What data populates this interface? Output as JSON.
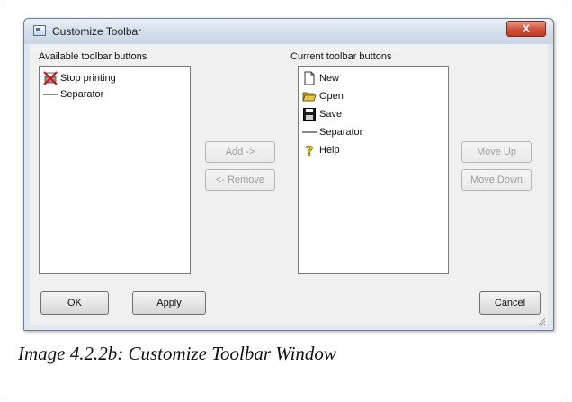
{
  "window": {
    "title": "Customize Toolbar",
    "close_label": "X"
  },
  "available": {
    "label": "Available toolbar buttons",
    "items": [
      {
        "label": "Stop printing",
        "icon": "stop-printing-icon"
      },
      {
        "label": "Separator",
        "icon": "separator-icon"
      }
    ]
  },
  "current": {
    "label": "Current toolbar buttons",
    "items": [
      {
        "label": "New",
        "icon": "new-document-icon"
      },
      {
        "label": "Open",
        "icon": "open-folder-icon"
      },
      {
        "label": "Save",
        "icon": "floppy-disk-icon"
      },
      {
        "label": "Separator",
        "icon": "separator-icon"
      },
      {
        "label": "Help",
        "icon": "help-icon"
      }
    ]
  },
  "buttons": {
    "add": "Add ->",
    "remove": "<- Remove",
    "move_up": "Move Up",
    "move_down": "Move Down",
    "ok": "OK",
    "apply": "Apply",
    "cancel": "Cancel"
  },
  "caption": "Image 4.2.2b: Customize Toolbar Window",
  "colors": {
    "window_bg": "#dfe7ef",
    "client_bg": "#f0f0f0",
    "close_red": "#c03a23"
  }
}
